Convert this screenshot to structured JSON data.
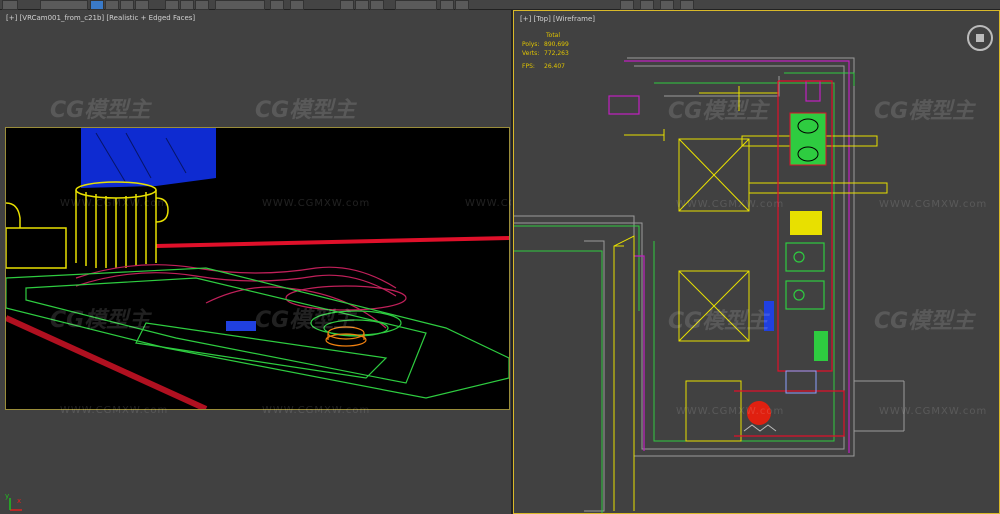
{
  "toolbar": {
    "buttons": 22
  },
  "left_viewport": {
    "label": "[+] [VRCam001_from_c21b] [Realistic + Edged Faces]",
    "axis_x": "x",
    "axis_y": "y"
  },
  "right_viewport": {
    "label": "[+] [Top] [Wireframe]",
    "stats": {
      "header": "Total",
      "polys_label": "Polys:",
      "polys_value": "890,699",
      "verts_label": "Verts:",
      "verts_value": "772,263",
      "fps_label": "FPS:",
      "fps_value": "26.407"
    }
  },
  "watermark": {
    "logo": "CG模型主",
    "url": "WWW.CGMXW.com"
  },
  "colors": {
    "viewport_bg": "#414141",
    "active_border": "#d9b92a",
    "stats_text": "#e0c400",
    "wire_yellow": "#e8e000",
    "wire_green": "#2ecc40",
    "wire_magenta": "#c020c0",
    "wire_red": "#e0102a",
    "wire_blue": "#1030e8"
  }
}
